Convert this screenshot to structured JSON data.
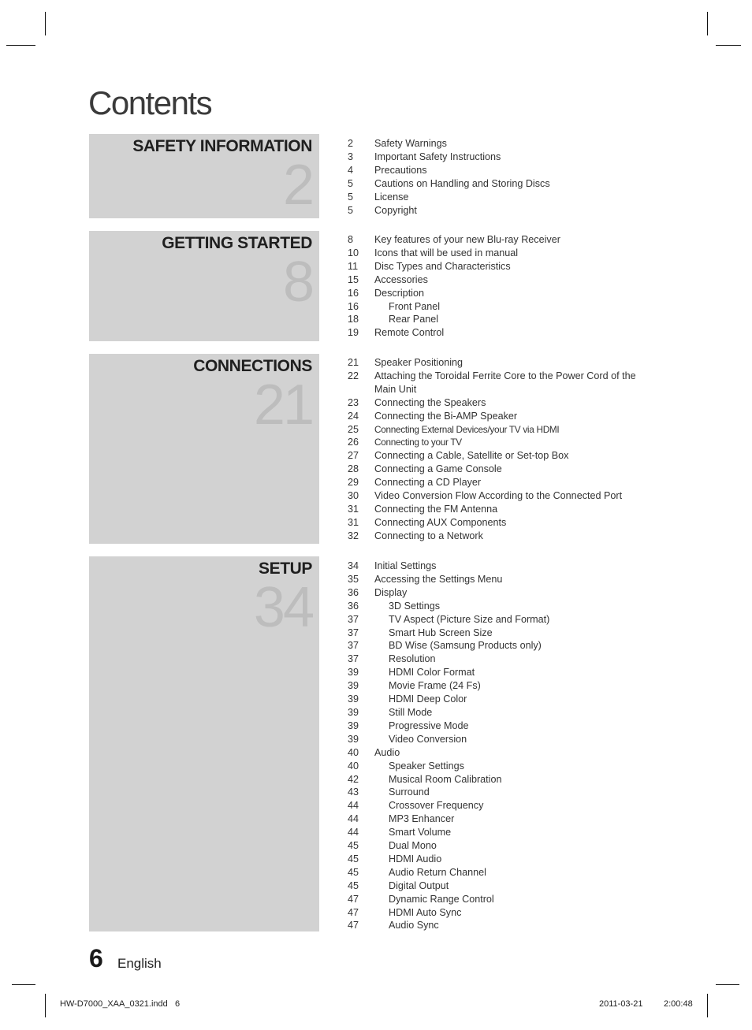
{
  "title": "Contents",
  "sections": [
    {
      "title": "SAFETY INFORMATION",
      "start_page": "2",
      "entries": [
        {
          "page": "2",
          "label": "Safety Warnings",
          "level": 1
        },
        {
          "page": "3",
          "label": "Important Safety Instructions",
          "level": 1
        },
        {
          "page": "4",
          "label": "Precautions",
          "level": 1
        },
        {
          "page": "5",
          "label": "Cautions on Handling and Storing Discs",
          "level": 1
        },
        {
          "page": "5",
          "label": "License",
          "level": 1
        },
        {
          "page": "5",
          "label": "Copyright",
          "level": 1
        }
      ]
    },
    {
      "title": "GETTING STARTED",
      "start_page": "8",
      "entries": [
        {
          "page": "8",
          "label": "Key features of your new Blu-ray Receiver",
          "level": 1
        },
        {
          "page": "10",
          "label": "Icons that will be used in manual",
          "level": 1
        },
        {
          "page": "11",
          "label": "Disc Types and Characteristics",
          "level": 1
        },
        {
          "page": "15",
          "label": "Accessories",
          "level": 1
        },
        {
          "page": "16",
          "label": "Description",
          "level": 1
        },
        {
          "page": "16",
          "label": "Front Panel",
          "level": 2
        },
        {
          "page": "18",
          "label": "Rear Panel",
          "level": 2
        },
        {
          "page": "19",
          "label": "Remote Control",
          "level": 1
        }
      ]
    },
    {
      "title": "CONNECTIONS",
      "start_page": "21",
      "entries": [
        {
          "page": "21",
          "label": "Speaker Positioning",
          "level": 1
        },
        {
          "page": "22",
          "label": "Attaching the Toroidal Ferrite Core to the Power Cord of the Main Unit",
          "level": 1
        },
        {
          "page": "23",
          "label": "Connecting the Speakers",
          "level": 1
        },
        {
          "page": "24",
          "label": "Connecting the Bi-AMP Speaker",
          "level": 1
        },
        {
          "page": "25",
          "label": "Connecting External Devices/your TV via HDMI",
          "level": 1,
          "small": true
        },
        {
          "page": "26",
          "label": "Connecting to your TV",
          "level": 1,
          "small": true
        },
        {
          "page": "27",
          "label": "Connecting a Cable, Satellite or Set-top Box",
          "level": 1
        },
        {
          "page": "28",
          "label": "Connecting a Game Console",
          "level": 1
        },
        {
          "page": "29",
          "label": "Connecting a CD Player",
          "level": 1
        },
        {
          "page": "30",
          "label": "Video Conversion Flow According to the Connected Port",
          "level": 1
        },
        {
          "page": "31",
          "label": "Connecting the FM Antenna",
          "level": 1
        },
        {
          "page": "31",
          "label": "Connecting AUX Components",
          "level": 1
        },
        {
          "page": "32",
          "label": "Connecting to a Network",
          "level": 1
        }
      ]
    },
    {
      "title": "SETUP",
      "start_page": "34",
      "entries": [
        {
          "page": "34",
          "label": "Initial Settings",
          "level": 1
        },
        {
          "page": "35",
          "label": "Accessing the Settings Menu",
          "level": 1
        },
        {
          "page": "36",
          "label": "Display",
          "level": 1
        },
        {
          "page": "36",
          "label": "3D Settings",
          "level": 2
        },
        {
          "page": "37",
          "label": "TV Aspect (Picture Size and Format)",
          "level": 2
        },
        {
          "page": "37",
          "label": "Smart Hub Screen Size",
          "level": 2
        },
        {
          "page": "37",
          "label": "BD Wise (Samsung Products only)",
          "level": 2
        },
        {
          "page": "37",
          "label": "Resolution",
          "level": 2
        },
        {
          "page": "39",
          "label": "HDMI Color Format",
          "level": 2
        },
        {
          "page": "39",
          "label": "Movie Frame (24 Fs)",
          "level": 2
        },
        {
          "page": "39",
          "label": "HDMI Deep Color",
          "level": 2
        },
        {
          "page": "39",
          "label": "Still Mode",
          "level": 2
        },
        {
          "page": "39",
          "label": "Progressive Mode",
          "level": 2
        },
        {
          "page": "39",
          "label": "Video Conversion",
          "level": 2
        },
        {
          "page": "40",
          "label": "Audio",
          "level": 1
        },
        {
          "page": "40",
          "label": "Speaker Settings",
          "level": 2
        },
        {
          "page": "42",
          "label": "Musical Room Calibration",
          "level": 2
        },
        {
          "page": "43",
          "label": "Surround",
          "level": 2
        },
        {
          "page": "44",
          "label": "Crossover Frequency",
          "level": 2
        },
        {
          "page": "44",
          "label": "MP3 Enhancer",
          "level": 2
        },
        {
          "page": "44",
          "label": "Smart Volume",
          "level": 2
        },
        {
          "page": "45",
          "label": "Dual Mono",
          "level": 2
        },
        {
          "page": "45",
          "label": "HDMI Audio",
          "level": 2
        },
        {
          "page": "45",
          "label": "Audio Return Channel",
          "level": 2
        },
        {
          "page": "45",
          "label": "Digital Output",
          "level": 2
        },
        {
          "page": "47",
          "label": "Dynamic Range Control",
          "level": 2
        },
        {
          "page": "47",
          "label": "HDMI Auto Sync",
          "level": 2
        },
        {
          "page": "47",
          "label": "Audio Sync",
          "level": 2
        }
      ]
    }
  ],
  "footer": {
    "page_number": "6",
    "language": "English"
  },
  "slug": {
    "file": "HW-D7000_XAA_0321.indd   6",
    "date": "2011-03-21",
    "time": "2:00:48"
  },
  "colors": {
    "section_box": "#d2d2d2",
    "section_number": "#bdbdbd",
    "section_title": "#1f1f1f"
  }
}
